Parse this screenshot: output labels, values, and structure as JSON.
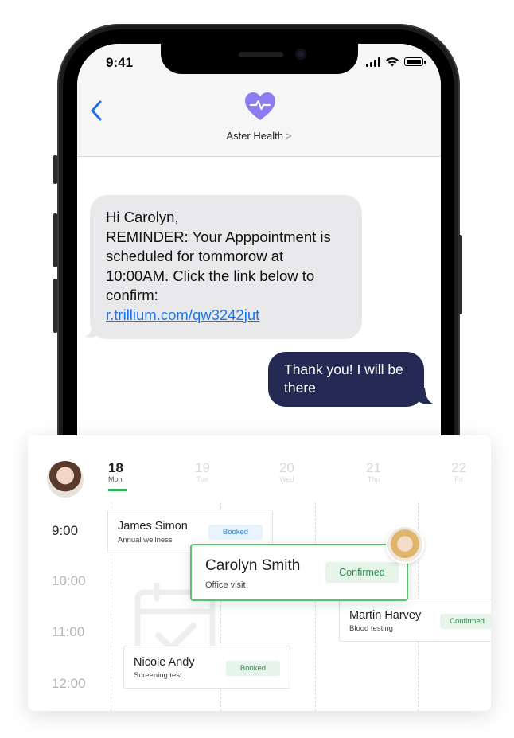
{
  "status_bar": {
    "time": "9:41"
  },
  "conversation": {
    "contact_name": "Aster Health",
    "contact_chevron": ">",
    "incoming_message": {
      "lines": [
        "Hi Carolyn,",
        "REMINDER: Your Apppointment is",
        "scheduled for tommorow at",
        "10:00AM. Click the link below to",
        "confirm:"
      ],
      "link": "r.trillium.com/qw3242jut"
    },
    "outgoing_message": "Thank you! I will be there"
  },
  "calendar": {
    "days": [
      {
        "num": "18",
        "dow": "Mon",
        "active": true
      },
      {
        "num": "19",
        "dow": "Tue",
        "active": false
      },
      {
        "num": "20",
        "dow": "Wed",
        "active": false
      },
      {
        "num": "21",
        "dow": "Thu",
        "active": false
      },
      {
        "num": "22",
        "dow": "Fri",
        "active": false
      }
    ],
    "times": [
      "9:00",
      "10:00",
      "11:00",
      "12:00"
    ],
    "appointments": [
      {
        "name": "James Simon",
        "type": "Annual wellness",
        "status": "Booked"
      },
      {
        "name": "Carolyn Smith",
        "type": "Office visit",
        "status": "Confirmed"
      },
      {
        "name": "Martin Harvey",
        "type": "Blood testing",
        "status": "Confirmed"
      },
      {
        "name": "Nicole Andy",
        "type": "Screening test",
        "status": "Booked"
      }
    ]
  },
  "colors": {
    "outgoing_bubble": "#242a54",
    "incoming_bubble": "#e9e9eb",
    "brand_heart": "#8b7df0",
    "link": "#1a73e8",
    "confirmed_border": "#5bbf72",
    "active_day_underline": "#2eb35a"
  },
  "icons": [
    "back-chevron-icon",
    "heart-pulse-icon",
    "signal-icon",
    "wifi-icon",
    "battery-icon",
    "calendar-check-icon"
  ]
}
